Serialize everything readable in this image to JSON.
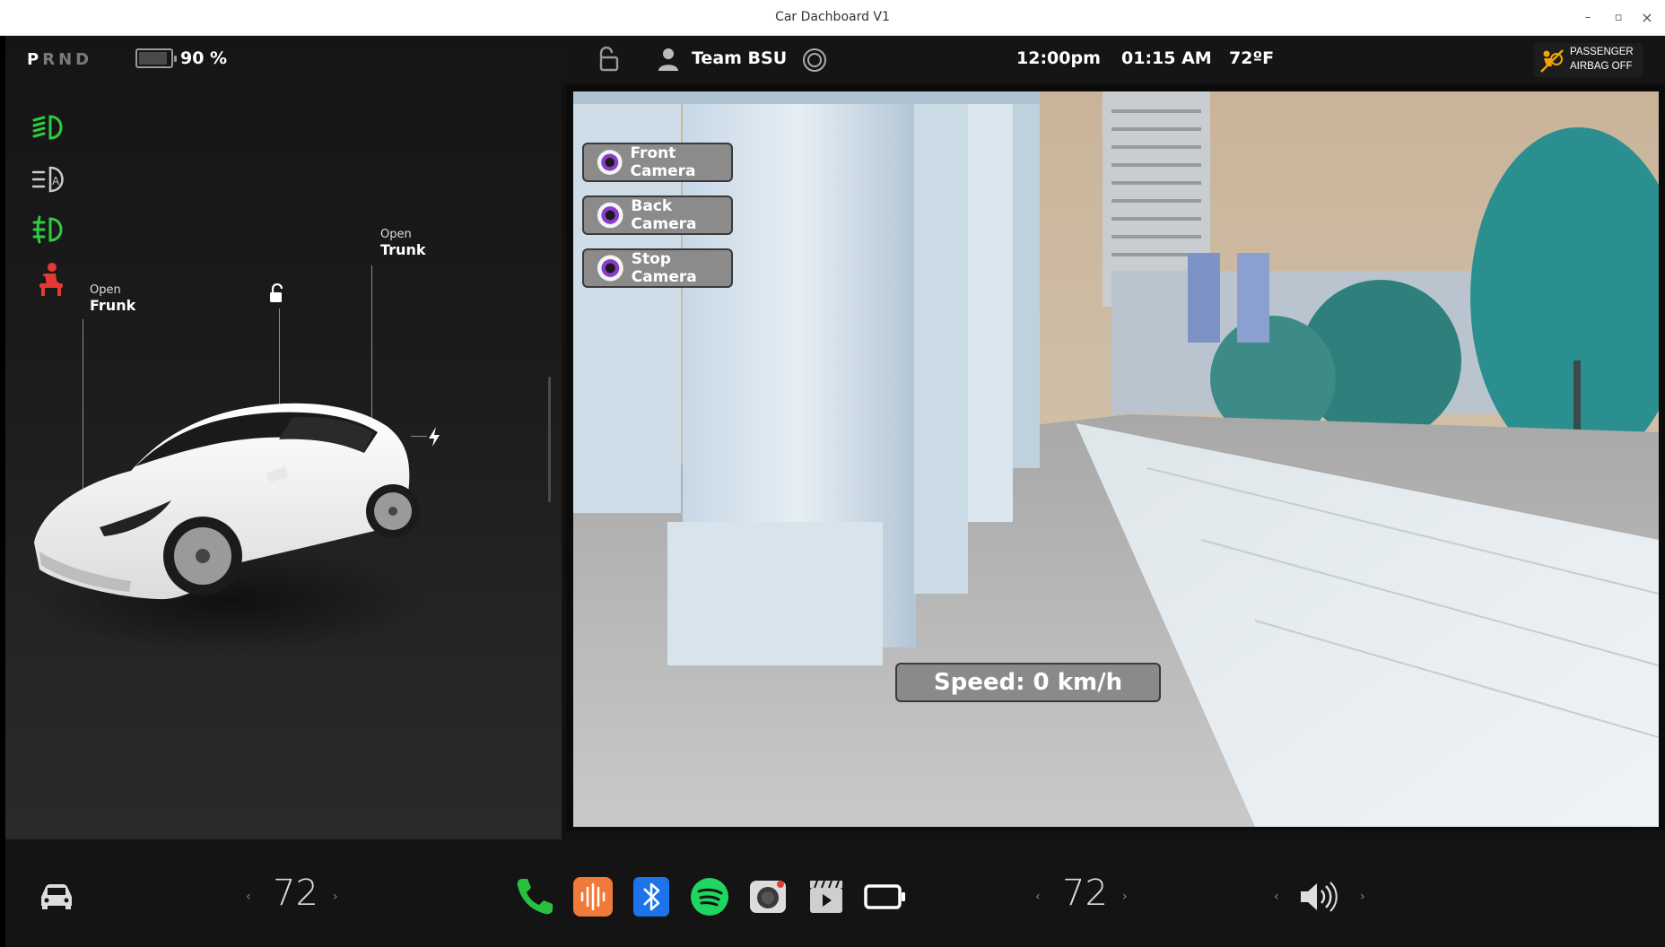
{
  "window": {
    "title": "Car Dachboard V1",
    "minimize": "–",
    "maximize": "▫",
    "close": "×"
  },
  "status": {
    "gears": [
      "P",
      "R",
      "N",
      "D"
    ],
    "active_gear": "P",
    "battery_text": "90 %",
    "battery_level": 0.9
  },
  "left_icons": [
    {
      "name": "low-beam-icon",
      "color": "#2ecc40"
    },
    {
      "name": "auto-headlight-icon",
      "color": "#cccccc"
    },
    {
      "name": "fog-light-icon",
      "color": "#2ecc40"
    },
    {
      "name": "seatbelt-warning-icon",
      "color": "#e53935"
    }
  ],
  "car": {
    "frunk": {
      "action": "Open",
      "label": "Frunk"
    },
    "trunk": {
      "action": "Open",
      "label": "Trunk"
    }
  },
  "topbar": {
    "profile": "Team BSU",
    "time1": "12:00pm",
    "time2": "01:15 AM",
    "temperature": "72ºF",
    "airbag_line1": "PASSENGER",
    "airbag_line2": "AIRBAG OFF"
  },
  "camera": {
    "buttons": [
      "Front Camera",
      "Back Camera",
      "Stop Camera"
    ],
    "speed": "Speed: 0 km/h"
  },
  "dock": {
    "left_temp": "72",
    "right_temp": "72",
    "chev_left": "‹",
    "chev_right": "›",
    "apps": [
      "car-icon",
      "phone-icon",
      "audio-icon",
      "bluetooth-icon",
      "spotify-icon",
      "camera-app-icon",
      "video-icon",
      "display-icon",
      "volume-icon"
    ]
  },
  "colors": {
    "accent_green": "#2ecc40",
    "warning_red": "#e53935",
    "camera_button": "#8b8b8b"
  }
}
